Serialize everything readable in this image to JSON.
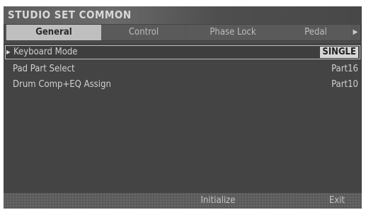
{
  "screen": {
    "title": "STUDIO SET COMMON"
  },
  "tabs": [
    {
      "label": "General",
      "active": true
    },
    {
      "label": "Control",
      "active": false
    },
    {
      "label": "Phase Lock",
      "active": false
    },
    {
      "label": "Pedal",
      "active": false
    }
  ],
  "params": [
    {
      "label": "Keyboard Mode",
      "value": "SINGLE",
      "selected": true
    },
    {
      "label": "Pad Part Select",
      "value": "Part16",
      "selected": false
    },
    {
      "label": "Drum Comp+EQ Assign",
      "value": "Part10",
      "selected": false
    }
  ],
  "bottom": {
    "initialize_label": "Initialize",
    "exit_label": "Exit"
  },
  "icons": {
    "cursor": "right-triangle-icon",
    "tab_scroll": "chevron-right-icon"
  }
}
